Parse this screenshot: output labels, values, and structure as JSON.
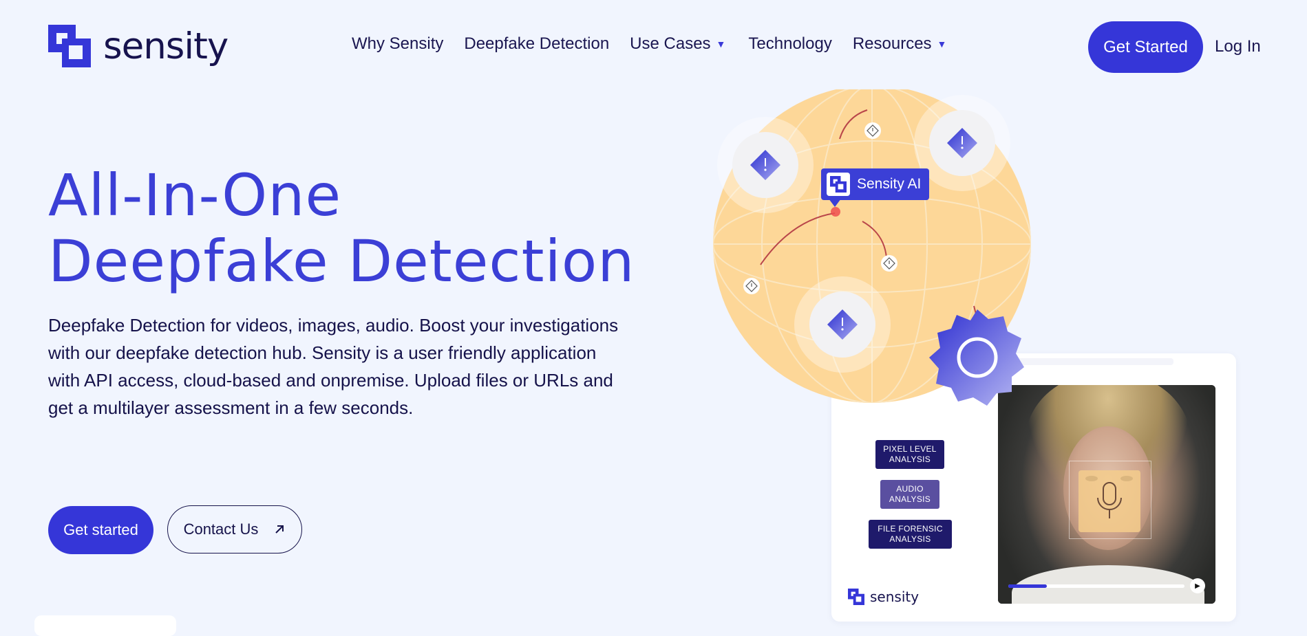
{
  "brand": {
    "name": "sensity",
    "color": "#3536d8"
  },
  "nav": {
    "items": [
      {
        "label": "Why Sensity",
        "dropdown": false
      },
      {
        "label": "Deepfake Detection",
        "dropdown": false
      },
      {
        "label": "Use Cases",
        "dropdown": true
      },
      {
        "label": "Technology",
        "dropdown": false
      },
      {
        "label": "Resources",
        "dropdown": true
      }
    ],
    "cta_label": "Get Started",
    "login_label": "Log In"
  },
  "hero": {
    "title_line1": "All-In-One",
    "title_line2": "Deepfake Detection",
    "description": "Deepfake Detection for videos, images, audio. Boost your investigations with our deepfake detection hub. Sensity is a user friendly application with API access, cloud-based and onpremise. Upload files or URLs and get a multilayer assessment in a few seconds.",
    "primary_button": "Get started",
    "secondary_button": "Contact Us"
  },
  "illustration": {
    "badge_label": "Sensity AI",
    "analysis_tags": [
      {
        "line1": "PIXEL LEVEL",
        "line2": "ANALYSIS"
      },
      {
        "line1": "AUDIO",
        "line2": "ANALYSIS"
      },
      {
        "line1": "FILE FORENSIC",
        "line2": "ANALYSIS"
      }
    ],
    "panel_logo": "sensity",
    "video_progress": 0.22,
    "icons": [
      "warning-diamond-icon",
      "gear-icon",
      "microphone-icon",
      "play-icon",
      "arrow-up-right-icon"
    ]
  }
}
